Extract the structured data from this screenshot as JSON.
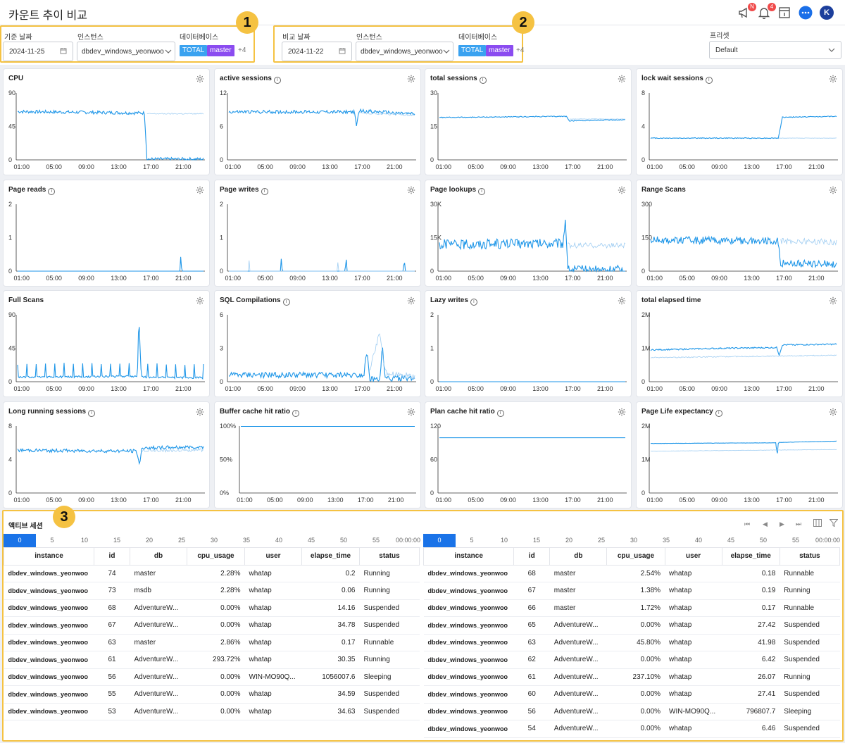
{
  "page": {
    "title": "카운트 추이 비교"
  },
  "header_icons": {
    "notice_badge": "N",
    "alert_badge": "4",
    "avatar": "K"
  },
  "base": {
    "date_label": "기준 날짜",
    "date": "2024-11-25",
    "instance_label": "인스턴스",
    "instance": "dbdev_windows_yeonwoo",
    "db_label": "데이터베이스",
    "tag_total": "TOTAL",
    "tag_master": "master",
    "more": "+4",
    "marker": "1"
  },
  "compare": {
    "date_label": "비교 날짜",
    "date": "2024-11-22",
    "instance_label": "인스턴스",
    "instance": "dbdev_windows_yeonwoo",
    "db_label": "데이터베이스",
    "tag_total": "TOTAL",
    "tag_master": "master",
    "more": "+4",
    "marker": "2"
  },
  "preset": {
    "label": "프리셋",
    "value": "Default"
  },
  "colors": {
    "primary": "#1e96e8",
    "compare": "#9fcdf2",
    "total_tag": "#3aa2f0",
    "master_tag": "#8b4cf0",
    "accent": "#f5c242",
    "active": "#1a73e8"
  },
  "chart_data": [
    {
      "type": "line",
      "title": "CPU",
      "info": false,
      "yticks": [
        "90",
        "45",
        "0"
      ],
      "ylim": [
        0,
        90
      ],
      "xticks": [
        "01:00",
        "05:00",
        "09:00",
        "13:00",
        "17:00",
        "21:00"
      ],
      "series": [
        {
          "values": [
            [
              0.5,
              65
            ],
            [
              16.2,
              63
            ],
            [
              16.5,
              1
            ],
            [
              23.5,
              1
            ]
          ],
          "noise": 2.2
        },
        {
          "values": [
            [
              16.5,
              62
            ],
            [
              23.5,
              62
            ]
          ],
          "noise": 0.8,
          "compare": true
        }
      ]
    },
    {
      "type": "line",
      "title": "active sessions",
      "info": true,
      "yticks": [
        "12",
        "6",
        "0"
      ],
      "ylim": [
        0,
        12
      ],
      "xticks": [
        "01:00",
        "05:00",
        "09:00",
        "13:00",
        "17:00",
        "21:00"
      ],
      "series": [
        {
          "values": [
            [
              0.5,
              8.6
            ],
            [
              16,
              8.6
            ],
            [
              16.3,
              6
            ],
            [
              16.6,
              8.8
            ],
            [
              23.5,
              8.2
            ]
          ],
          "noise": 0.3
        },
        {
          "values": [
            [
              16.6,
              8.4
            ],
            [
              23.5,
              8
            ]
          ],
          "noise": 0.15,
          "compare": true
        }
      ]
    },
    {
      "type": "line",
      "title": "total sessions",
      "info": true,
      "yticks": [
        "30",
        "15",
        "0"
      ],
      "ylim": [
        0,
        30
      ],
      "xticks": [
        "01:00",
        "05:00",
        "09:00",
        "13:00",
        "17:00",
        "21:00"
      ],
      "series": [
        {
          "values": [
            [
              0.5,
              19
            ],
            [
              16.2,
              19.5
            ],
            [
              16.6,
              17.5
            ],
            [
              23.5,
              18
            ]
          ],
          "noise": 0.2
        },
        {
          "values": [
            [
              16.6,
              18.3
            ],
            [
              23.5,
              18.3
            ]
          ],
          "noise": 0.1,
          "compare": true
        }
      ]
    },
    {
      "type": "line",
      "title": "lock wait sessions",
      "info": true,
      "yticks": [
        "8",
        "4",
        "0"
      ],
      "ylim": [
        0,
        8
      ],
      "xticks": [
        "01:00",
        "05:00",
        "09:00",
        "13:00",
        "17:00",
        "21:00"
      ],
      "series": [
        {
          "values": [
            [
              0.5,
              2.6
            ],
            [
              16.3,
              2.6
            ],
            [
              16.8,
              5.1
            ],
            [
              23.5,
              5.2
            ]
          ],
          "noise": 0.05
        },
        {
          "values": [
            [
              16.3,
              2.6
            ],
            [
              23.5,
              2.6
            ]
          ],
          "noise": 0.02,
          "compare": true
        }
      ]
    },
    {
      "type": "line",
      "title": "Page reads",
      "info": true,
      "yticks": [
        "2",
        "1",
        "0"
      ],
      "ylim": [
        0,
        2
      ],
      "xticks": [
        "01:00",
        "05:00",
        "09:00",
        "13:00",
        "17:00",
        "21:00"
      ],
      "series": [
        {
          "values": [
            [
              0.5,
              0
            ],
            [
              20.6,
              0
            ],
            [
              20.7,
              0.55
            ],
            [
              20.8,
              0
            ],
            [
              23.5,
              0
            ]
          ],
          "noise": 0
        }
      ]
    },
    {
      "type": "line",
      "title": "Page writes",
      "info": true,
      "yticks": [
        "2",
        "1",
        "0"
      ],
      "ylim": [
        0,
        2
      ],
      "xticks": [
        "01:00",
        "05:00",
        "09:00",
        "13:00",
        "17:00",
        "21:00"
      ],
      "series": [
        {
          "values": [
            [
              0.5,
              0
            ],
            [
              6.9,
              0
            ],
            [
              7.0,
              0.45
            ],
            [
              7.1,
              0
            ],
            [
              14.9,
              0
            ],
            [
              15.0,
              0.5
            ],
            [
              15.1,
              0
            ],
            [
              22.1,
              0
            ],
            [
              22.2,
              0.45
            ],
            [
              22.3,
              0
            ],
            [
              23.5,
              0
            ]
          ],
          "noise": 0
        },
        {
          "values": [
            [
              0.5,
              0
            ],
            [
              2.9,
              0
            ],
            [
              3.0,
              0.35
            ],
            [
              3.1,
              0
            ],
            [
              13.9,
              0
            ],
            [
              14.0,
              0.3
            ],
            [
              14.1,
              0
            ],
            [
              23.5,
              0
            ]
          ],
          "noise": 0,
          "compare": true
        }
      ]
    },
    {
      "type": "line",
      "title": "Page lookups",
      "info": true,
      "yticks": [
        "30K",
        "15K",
        "0"
      ],
      "ylim": [
        0,
        30000
      ],
      "xticks": [
        "01:00",
        "05:00",
        "09:00",
        "13:00",
        "17:00",
        "21:00"
      ],
      "series": [
        {
          "values": [
            [
              0.5,
              12000
            ],
            [
              15.8,
              12500
            ],
            [
              16.1,
              24000
            ],
            [
              16.4,
              500
            ],
            [
              23.5,
              500
            ]
          ],
          "noise": 2200
        },
        {
          "values": [
            [
              16.4,
              11500
            ],
            [
              23.5,
              11500
            ]
          ],
          "noise": 1200,
          "compare": true
        }
      ]
    },
    {
      "type": "line",
      "title": "Range Scans",
      "info": false,
      "yticks": [
        "300",
        "150",
        "0"
      ],
      "ylim": [
        0,
        300
      ],
      "xticks": [
        "01:00",
        "05:00",
        "09:00",
        "13:00",
        "17:00",
        "21:00"
      ],
      "series": [
        {
          "values": [
            [
              0.5,
              140
            ],
            [
              16.2,
              135
            ],
            [
              16.6,
              35
            ],
            [
              23.5,
              32
            ]
          ],
          "noise": 16
        },
        {
          "values": [
            [
              16.6,
              135
            ],
            [
              23.5,
              130
            ]
          ],
          "noise": 14,
          "compare": true
        }
      ]
    },
    {
      "type": "line",
      "title": "Full Scans",
      "info": false,
      "yticks": [
        "90",
        "45",
        "0"
      ],
      "ylim": [
        0,
        90
      ],
      "xticks": [
        "01:00",
        "05:00",
        "09:00",
        "13:00",
        "17:00",
        "21:00"
      ],
      "series": [
        {
          "values": [
            [
              0.5,
              5
            ],
            [
              15.3,
              6
            ],
            [
              15.55,
              73
            ],
            [
              15.8,
              5
            ],
            [
              23.5,
              4
            ]
          ],
          "noise": 5,
          "spiky": true
        }
      ]
    },
    {
      "type": "line",
      "title": "SQL Compilations",
      "info": true,
      "yticks": [
        "6",
        "3",
        "0"
      ],
      "ylim": [
        0,
        6
      ],
      "xticks": [
        "01:00",
        "05:00",
        "09:00",
        "13:00",
        "17:00",
        "21:00"
      ],
      "series": [
        {
          "values": [
            [
              0.5,
              0.6
            ],
            [
              17.2,
              0.6
            ],
            [
              17.6,
              3
            ],
            [
              17.9,
              0.2
            ],
            [
              19.2,
              0.2
            ],
            [
              19.5,
              3.3
            ],
            [
              19.8,
              0.3
            ],
            [
              23.5,
              0.3
            ]
          ],
          "noise": 0.25
        },
        {
          "values": [
            [
              17.9,
              1
            ],
            [
              19.2,
              4.5
            ],
            [
              19.8,
              0.8
            ],
            [
              23.5,
              0.5
            ]
          ],
          "noise": 0.3,
          "compare": true
        }
      ]
    },
    {
      "type": "line",
      "title": "Lazy writes",
      "info": true,
      "yticks": [
        "2",
        "1",
        "0"
      ],
      "ylim": [
        0,
        2
      ],
      "xticks": [
        "01:00",
        "05:00",
        "09:00",
        "13:00",
        "17:00",
        "21:00"
      ],
      "series": [
        {
          "values": [
            [
              0.5,
              0
            ],
            [
              23.5,
              0
            ]
          ],
          "noise": 0
        }
      ]
    },
    {
      "type": "line",
      "title": "total elapsed time",
      "info": false,
      "yticks": [
        "2M",
        "1M",
        "0"
      ],
      "ylim": [
        0,
        2000000
      ],
      "xticks": [
        "01:00",
        "05:00",
        "09:00",
        "13:00",
        "17:00",
        "21:00"
      ],
      "series": [
        {
          "values": [
            [
              0.5,
              950000
            ],
            [
              9.5,
              1000000
            ],
            [
              16.1,
              1020000
            ],
            [
              16.4,
              800000
            ],
            [
              16.8,
              1100000
            ],
            [
              23.5,
              1120000
            ]
          ],
          "noise": 20000
        },
        {
          "values": [
            [
              0.5,
              720000
            ],
            [
              23.5,
              790000
            ]
          ],
          "noise": 15000,
          "compare": true
        }
      ]
    },
    {
      "type": "line",
      "title": "Long running sessions",
      "info": true,
      "yticks": [
        "8",
        "4",
        "0"
      ],
      "ylim": [
        0,
        8
      ],
      "xticks": [
        "01:00",
        "05:00",
        "09:00",
        "13:00",
        "17:00",
        "21:00"
      ],
      "series": [
        {
          "values": [
            [
              0.5,
              5.1
            ],
            [
              15.2,
              5.0
            ],
            [
              15.6,
              3.4
            ],
            [
              15.9,
              5.4
            ],
            [
              23.5,
              5.5
            ]
          ],
          "noise": 0.2
        },
        {
          "values": [
            [
              15.9,
              5.1
            ],
            [
              23.5,
              5.1
            ]
          ],
          "noise": 0.2,
          "compare": true
        }
      ]
    },
    {
      "type": "line",
      "title": "Buffer cache hit ratio",
      "info": true,
      "yticks": [
        "100%",
        "50%",
        "0%"
      ],
      "ylim": [
        0,
        100
      ],
      "xticks": [
        "01:00",
        "05:00",
        "09:00",
        "13:00",
        "17:00",
        "21:00"
      ],
      "series": [
        {
          "values": [
            [
              0.5,
              99.5
            ],
            [
              23.5,
              99.5
            ]
          ],
          "noise": 0
        }
      ]
    },
    {
      "type": "line",
      "title": "Plan cache hit ratio",
      "info": true,
      "yticks": [
        "120",
        "60",
        "0"
      ],
      "ylim": [
        0,
        120
      ],
      "xticks": [
        "01:00",
        "05:00",
        "09:00",
        "13:00",
        "17:00",
        "21:00"
      ],
      "series": [
        {
          "values": [
            [
              0.5,
              99
            ],
            [
              23.5,
              99
            ]
          ],
          "noise": 0
        }
      ]
    },
    {
      "type": "line",
      "title": "Page Life expectancy",
      "info": true,
      "yticks": [
        "2M",
        "1M",
        "0"
      ],
      "ylim": [
        0,
        2000000
      ],
      "xticks": [
        "01:00",
        "05:00",
        "09:00",
        "13:00",
        "17:00",
        "21:00"
      ],
      "series": [
        {
          "values": [
            [
              0.5,
              1480000
            ],
            [
              16,
              1500000
            ],
            [
              16.15,
              1100000
            ],
            [
              16.3,
              1510000
            ],
            [
              23.5,
              1550000
            ]
          ],
          "noise": 4000
        },
        {
          "values": [
            [
              0.5,
              1250000
            ],
            [
              23.5,
              1300000
            ]
          ],
          "noise": 5000,
          "compare": true
        }
      ]
    }
  ],
  "session": {
    "title": "액티브 세션",
    "timeline": [
      "0",
      "5",
      "10",
      "15",
      "20",
      "25",
      "30",
      "35",
      "40",
      "45",
      "50",
      "55",
      "00:00:00"
    ],
    "columns": [
      "instance",
      "id",
      "db",
      "cpu_usage",
      "user",
      "elapse_time",
      "status"
    ],
    "left_rows": [
      [
        "dbdev_windows_yeonwoo",
        "74",
        "master",
        "2.28%",
        "whatap",
        "0.2",
        "Running"
      ],
      [
        "dbdev_windows_yeonwoo",
        "73",
        "msdb",
        "2.28%",
        "whatap",
        "0.06",
        "Running"
      ],
      [
        "dbdev_windows_yeonwoo",
        "68",
        "AdventureW...",
        "0.00%",
        "whatap",
        "14.16",
        "Suspended"
      ],
      [
        "dbdev_windows_yeonwoo",
        "67",
        "AdventureW...",
        "0.00%",
        "whatap",
        "34.78",
        "Suspended"
      ],
      [
        "dbdev_windows_yeonwoo",
        "63",
        "master",
        "2.86%",
        "whatap",
        "0.17",
        "Runnable"
      ],
      [
        "dbdev_windows_yeonwoo",
        "61",
        "AdventureW...",
        "293.72%",
        "whatap",
        "30.35",
        "Running"
      ],
      [
        "dbdev_windows_yeonwoo",
        "56",
        "AdventureW...",
        "0.00%",
        "WIN-MO90Q...",
        "1056007.6",
        "Sleeping"
      ],
      [
        "dbdev_windows_yeonwoo",
        "55",
        "AdventureW...",
        "0.00%",
        "whatap",
        "34.59",
        "Suspended"
      ],
      [
        "dbdev_windows_yeonwoo",
        "53",
        "AdventureW...",
        "0.00%",
        "whatap",
        "34.63",
        "Suspended"
      ]
    ],
    "right_rows": [
      [
        "dbdev_windows_yeonwoo",
        "68",
        "master",
        "2.54%",
        "whatap",
        "0.18",
        "Runnable"
      ],
      [
        "dbdev_windows_yeonwoo",
        "67",
        "master",
        "1.38%",
        "whatap",
        "0.19",
        "Running"
      ],
      [
        "dbdev_windows_yeonwoo",
        "66",
        "master",
        "1.72%",
        "whatap",
        "0.17",
        "Runnable"
      ],
      [
        "dbdev_windows_yeonwoo",
        "65",
        "AdventureW...",
        "0.00%",
        "whatap",
        "27.42",
        "Suspended"
      ],
      [
        "dbdev_windows_yeonwoo",
        "63",
        "AdventureW...",
        "45.80%",
        "whatap",
        "41.98",
        "Suspended"
      ],
      [
        "dbdev_windows_yeonwoo",
        "62",
        "AdventureW...",
        "0.00%",
        "whatap",
        "6.42",
        "Suspended"
      ],
      [
        "dbdev_windows_yeonwoo",
        "61",
        "AdventureW...",
        "237.10%",
        "whatap",
        "26.07",
        "Running"
      ],
      [
        "dbdev_windows_yeonwoo",
        "60",
        "AdventureW...",
        "0.00%",
        "whatap",
        "27.41",
        "Suspended"
      ],
      [
        "dbdev_windows_yeonwoo",
        "56",
        "AdventureW...",
        "0.00%",
        "WIN-MO90Q...",
        "796807.7",
        "Sleeping"
      ],
      [
        "dbdev_windows_yeonwoo",
        "54",
        "AdventureW...",
        "0.00%",
        "whatap",
        "6.46",
        "Suspended"
      ]
    ],
    "marker": "3"
  }
}
